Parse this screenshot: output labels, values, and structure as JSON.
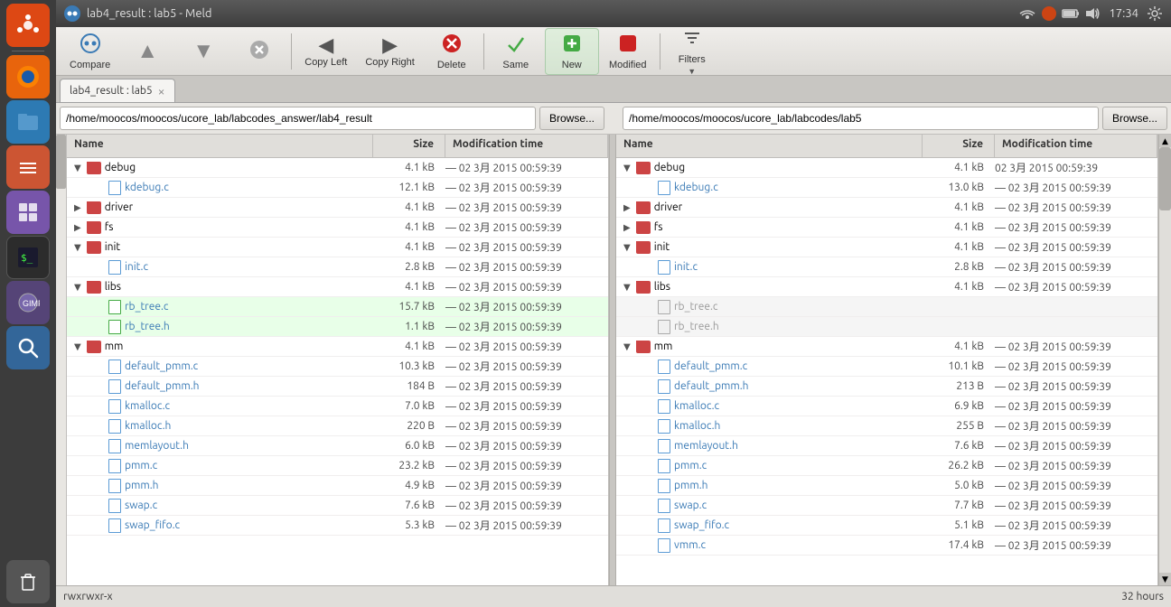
{
  "titlebar": {
    "title": "lab4_result : lab5 - Meld"
  },
  "toolbar": {
    "compare_label": "Compare",
    "copy_left_label": "Copy Left",
    "copy_right_label": "Copy Right",
    "delete_label": "Delete",
    "same_label": "Same",
    "new_label": "New",
    "modified_label": "Modified",
    "filters_label": "Filters"
  },
  "tab": {
    "label": "lab4_result : lab5",
    "close_label": "×"
  },
  "left_panel": {
    "path": "/home/moocos/moocos/ucore_lab/labcodes_answer/lab4_result",
    "browse_label": "Browse...",
    "col_name": "Name",
    "col_size": "Size",
    "col_mtime": "Modification time"
  },
  "right_panel": {
    "path": "/home/moocos/moocos/ucore_lab/labcodes/lab5",
    "browse_label": "Browse...",
    "col_name": "Name",
    "col_size": "Size",
    "col_mtime": "Modification time"
  },
  "statusbar": {
    "permissions": "rwxrwxr-x",
    "time": "32 hours"
  },
  "time_display": "17:34",
  "left_files": [
    {
      "indent": 1,
      "type": "folder-mod",
      "expand": "▼",
      "name": "debug",
      "size": "4.1 kB",
      "mtime": "— 02 3月 2015 00:59:39"
    },
    {
      "indent": 2,
      "type": "file",
      "expand": "",
      "name": "kdebug.c",
      "size": "12.1 kB",
      "mtime": "— 02 3月 2015 00:59:39"
    },
    {
      "indent": 1,
      "type": "folder-mod",
      "expand": "▶",
      "name": "driver",
      "size": "4.1 kB",
      "mtime": "— 02 3月 2015 00:59:39"
    },
    {
      "indent": 1,
      "type": "folder-mod",
      "expand": "▶",
      "name": "fs",
      "size": "4.1 kB",
      "mtime": "— 02 3月 2015 00:59:39"
    },
    {
      "indent": 1,
      "type": "folder-mod",
      "expand": "▼",
      "name": "init",
      "size": "4.1 kB",
      "mtime": "— 02 3月 2015 00:59:39"
    },
    {
      "indent": 2,
      "type": "file",
      "expand": "",
      "name": "init.c",
      "size": "2.8 kB",
      "mtime": "— 02 3月 2015 00:59:39"
    },
    {
      "indent": 1,
      "type": "folder-mod",
      "expand": "▼",
      "name": "libs",
      "size": "4.1 kB",
      "mtime": "— 02 3月 2015 00:59:39"
    },
    {
      "indent": 2,
      "type": "file-green",
      "expand": "",
      "name": "rb_tree.c",
      "size": "15.7 kB",
      "mtime": "— 02 3月 2015 00:59:39"
    },
    {
      "indent": 2,
      "type": "file-green",
      "expand": "",
      "name": "rb_tree.h",
      "size": "1.1 kB",
      "mtime": "— 02 3月 2015 00:59:39"
    },
    {
      "indent": 1,
      "type": "folder-mod",
      "expand": "▼",
      "name": "mm",
      "size": "4.1 kB",
      "mtime": "— 02 3月 2015 00:59:39"
    },
    {
      "indent": 2,
      "type": "file",
      "expand": "",
      "name": "default_pmm.c",
      "size": "10.3 kB",
      "mtime": "— 02 3月 2015 00:59:39"
    },
    {
      "indent": 2,
      "type": "file",
      "expand": "",
      "name": "default_pmm.h",
      "size": "184 B",
      "mtime": "— 02 3月 2015 00:59:39"
    },
    {
      "indent": 2,
      "type": "file",
      "expand": "",
      "name": "kmalloc.c",
      "size": "7.0 kB",
      "mtime": "— 02 3月 2015 00:59:39"
    },
    {
      "indent": 2,
      "type": "file",
      "expand": "",
      "name": "kmalloc.h",
      "size": "220 B",
      "mtime": "— 02 3月 2015 00:59:39"
    },
    {
      "indent": 2,
      "type": "file",
      "expand": "",
      "name": "memlayout.h",
      "size": "6.0 kB",
      "mtime": "— 02 3月 2015 00:59:39"
    },
    {
      "indent": 2,
      "type": "file",
      "expand": "",
      "name": "pmm.c",
      "size": "23.2 kB",
      "mtime": "— 02 3月 2015 00:59:39"
    },
    {
      "indent": 2,
      "type": "file",
      "expand": "",
      "name": "pmm.h",
      "size": "4.9 kB",
      "mtime": "— 02 3月 2015 00:59:39"
    },
    {
      "indent": 2,
      "type": "file",
      "expand": "",
      "name": "swap.c",
      "size": "7.6 kB",
      "mtime": "— 02 3月 2015 00:59:39"
    },
    {
      "indent": 2,
      "type": "file",
      "expand": "",
      "name": "swap_fifo.c",
      "size": "5.3 kB",
      "mtime": "— 02 3月 2015 00:59:39"
    }
  ],
  "right_files": [
    {
      "indent": 1,
      "type": "folder-mod",
      "expand": "▼",
      "name": "debug",
      "size": "4.1 kB",
      "mtime": "02 3月 2015 00:59:39"
    },
    {
      "indent": 2,
      "type": "file",
      "expand": "",
      "name": "kdebug.c",
      "size": "13.0 kB",
      "mtime": "— 02 3月 2015 00:59:39"
    },
    {
      "indent": 1,
      "type": "folder-mod",
      "expand": "▶",
      "name": "driver",
      "size": "4.1 kB",
      "mtime": "— 02 3月 2015 00:59:39"
    },
    {
      "indent": 1,
      "type": "folder-mod",
      "expand": "▶",
      "name": "fs",
      "size": "4.1 kB",
      "mtime": "— 02 3月 2015 00:59:39"
    },
    {
      "indent": 1,
      "type": "folder-mod",
      "expand": "▼",
      "name": "init",
      "size": "4.1 kB",
      "mtime": "— 02 3月 2015 00:59:39"
    },
    {
      "indent": 2,
      "type": "file",
      "expand": "",
      "name": "init.c",
      "size": "2.8 kB",
      "mtime": "— 02 3月 2015 00:59:39"
    },
    {
      "indent": 1,
      "type": "folder-mod",
      "expand": "▼",
      "name": "libs",
      "size": "4.1 kB",
      "mtime": "— 02 3月 2015 00:59:39"
    },
    {
      "indent": 2,
      "type": "file-disabled",
      "expand": "",
      "name": "rb_tree.c",
      "size": "",
      "mtime": ""
    },
    {
      "indent": 2,
      "type": "file-disabled",
      "expand": "",
      "name": "rb_tree.h",
      "size": "",
      "mtime": ""
    },
    {
      "indent": 1,
      "type": "folder-mod",
      "expand": "▼",
      "name": "mm",
      "size": "4.1 kB",
      "mtime": "— 02 3月 2015 00:59:39"
    },
    {
      "indent": 2,
      "type": "file",
      "expand": "",
      "name": "default_pmm.c",
      "size": "10.1 kB",
      "mtime": "— 02 3月 2015 00:59:39"
    },
    {
      "indent": 2,
      "type": "file",
      "expand": "",
      "name": "default_pmm.h",
      "size": "213 B",
      "mtime": "— 02 3月 2015 00:59:39"
    },
    {
      "indent": 2,
      "type": "file",
      "expand": "",
      "name": "kmalloc.c",
      "size": "6.9 kB",
      "mtime": "— 02 3月 2015 00:59:39"
    },
    {
      "indent": 2,
      "type": "file",
      "expand": "",
      "name": "kmalloc.h",
      "size": "255 B",
      "mtime": "— 02 3月 2015 00:59:39"
    },
    {
      "indent": 2,
      "type": "file",
      "expand": "",
      "name": "memlayout.h",
      "size": "7.6 kB",
      "mtime": "— 02 3月 2015 00:59:39"
    },
    {
      "indent": 2,
      "type": "file",
      "expand": "",
      "name": "pmm.c",
      "size": "26.2 kB",
      "mtime": "— 02 3月 2015 00:59:39"
    },
    {
      "indent": 2,
      "type": "file",
      "expand": "",
      "name": "pmm.h",
      "size": "5.0 kB",
      "mtime": "— 02 3月 2015 00:59:39"
    },
    {
      "indent": 2,
      "type": "file",
      "expand": "",
      "name": "swap.c",
      "size": "7.7 kB",
      "mtime": "— 02 3月 2015 00:59:39"
    },
    {
      "indent": 2,
      "type": "file",
      "expand": "",
      "name": "swap_fifo.c",
      "size": "5.1 kB",
      "mtime": "— 02 3月 2015 00:59:39"
    },
    {
      "indent": 2,
      "type": "file",
      "expand": "",
      "name": "vmm.c",
      "size": "17.4 kB",
      "mtime": "— 02 3月 2015 00:59:39"
    }
  ]
}
